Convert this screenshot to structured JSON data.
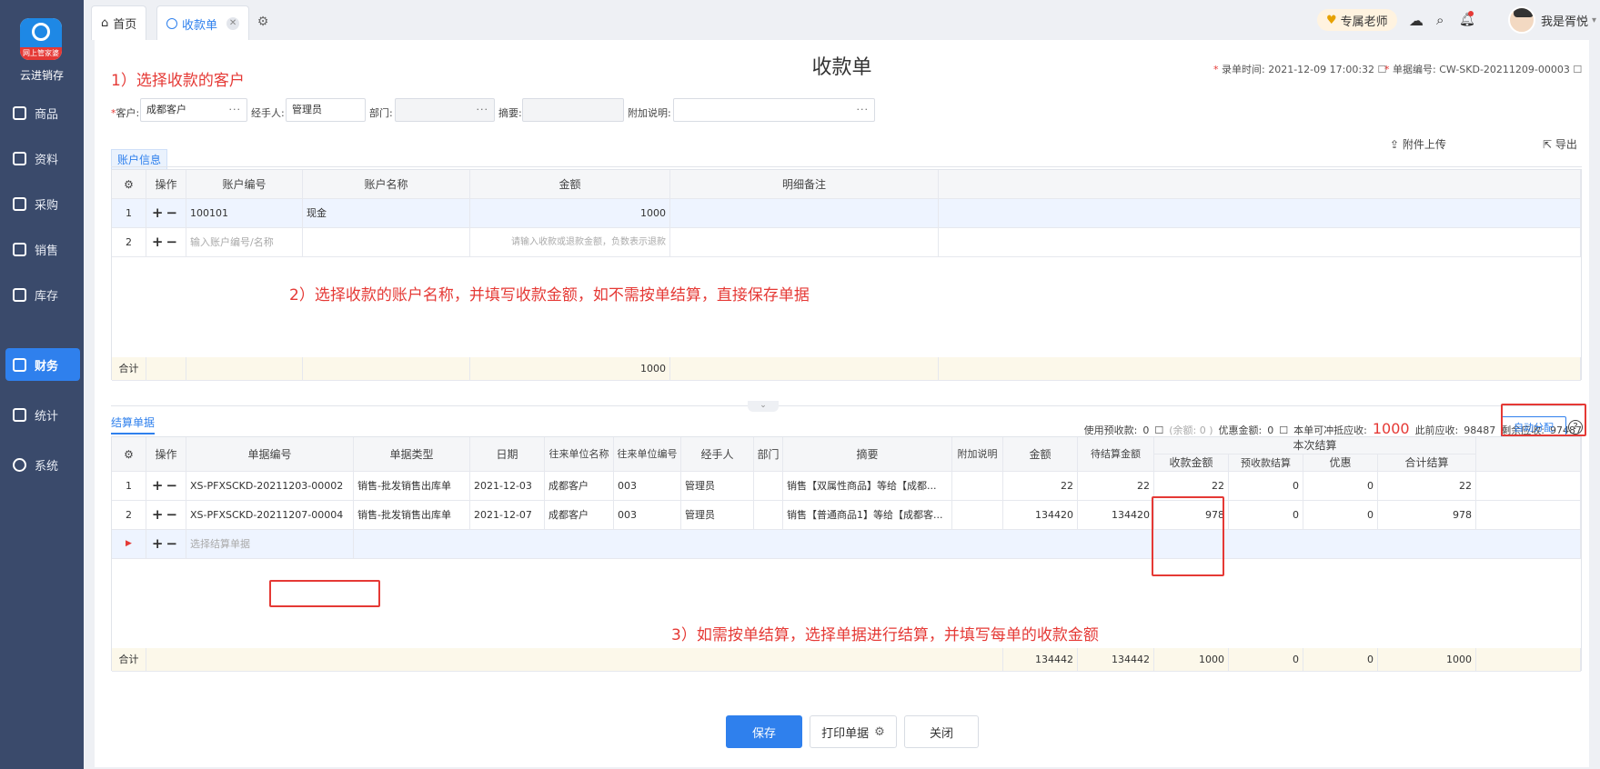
{
  "app": {
    "brand": "云进销存",
    "logo_band": "网上管家婆"
  },
  "nav": [
    {
      "label": "商品",
      "icon": "goods-icon"
    },
    {
      "label": "资料",
      "icon": "profile-icon"
    },
    {
      "label": "采购",
      "icon": "purchase-icon"
    },
    {
      "label": "销售",
      "icon": "sales-icon"
    },
    {
      "label": "库存",
      "icon": "inventory-icon"
    },
    {
      "label": "财务",
      "icon": "finance-icon",
      "active": true
    },
    {
      "label": "统计",
      "icon": "stats-icon"
    },
    {
      "label": "系统",
      "icon": "system-icon"
    }
  ],
  "tabs": [
    {
      "label": "首页"
    },
    {
      "label": "收款单",
      "active": true
    }
  ],
  "topbar": {
    "teacher": "专属老师",
    "user": "我是胥悦"
  },
  "page": {
    "title": "收款单",
    "entry_time_label": "录单时间:",
    "entry_time": "2021-12-09 17:00:32",
    "doc_no_label": "单据编号:",
    "doc_no": "CW-SKD-20211209-00003"
  },
  "annotations": {
    "a1": "1）选择收款的客户",
    "a2": "2）选择收款的账户名称，并填写收款金额，如不需按单结算，直接保存单据",
    "a3": "3）如需按单结算，选择单据进行结算，并填写每单的收款金额"
  },
  "form": {
    "customer_label": "客户:",
    "customer": "成都客户",
    "handler_label": "经手人:",
    "handler": "管理员",
    "dept_label": "部门:",
    "dept": "",
    "summary_label": "摘要:",
    "summary": "",
    "note_label": "附加说明:",
    "note": ""
  },
  "actions": {
    "upload": "附件上传",
    "export": "导出"
  },
  "account": {
    "tab": "账户信息",
    "headers": [
      "操作",
      "账户编号",
      "账户名称",
      "金额",
      "明细备注"
    ],
    "rows": [
      {
        "no": "1",
        "code": "100101",
        "name": "现金",
        "amount": "1000",
        "remark": ""
      },
      {
        "no": "2",
        "code": "输入账户编号/名称",
        "name": "",
        "amount": "请输入收款或退款金额，负数表示退款",
        "remark": ""
      }
    ],
    "total_label": "合计",
    "total": "1000"
  },
  "summary": {
    "prepay_label": "使用预收款:",
    "prepay": "0",
    "balance": "(余额: 0 )",
    "discount_label": "优惠金额:",
    "discount": "0",
    "offset_label": "本单可冲抵应收:",
    "offset": "1000",
    "before_label": "此前应收:",
    "before": "98487",
    "remain_label": "剩余应收:",
    "remain": "97487"
  },
  "settle": {
    "tab": "结算单据",
    "auto_btn": "自动分配",
    "group_header": "本次结算",
    "headers": [
      "操作",
      "单据编号",
      "单据类型",
      "日期",
      "往来单位名称",
      "往来单位编号",
      "经手人",
      "部门",
      "摘要",
      "附加说明",
      "金额",
      "待结算金额",
      "收款金额",
      "预收款结算",
      "优惠",
      "合计结算"
    ],
    "rows": [
      {
        "no": "1",
        "code": "XS-PFXSCKD-20211203-00002",
        "type": "销售-批发销售出库单",
        "date": "2021-12-03",
        "unit": "成都客户",
        "unit_no": "003",
        "handler": "管理员",
        "dept": "",
        "summary": "销售【双属性商品】等给【成都...",
        "note": "",
        "amount": "22",
        "pending": "22",
        "receive": "22",
        "prepay": "0",
        "discount": "0",
        "total": "22"
      },
      {
        "no": "2",
        "code": "XS-PFXSCKD-20211207-00004",
        "type": "销售-批发销售出库单",
        "date": "2021-12-07",
        "unit": "成都客户",
        "unit_no": "003",
        "handler": "管理员",
        "dept": "",
        "summary": "销售【普通商品1】等给【成都客...",
        "note": "",
        "amount": "134420",
        "pending": "134420",
        "receive": "978",
        "prepay": "0",
        "discount": "0",
        "total": "978"
      }
    ],
    "new_row_placeholder": "选择结算单据",
    "total_label": "合计",
    "totals": {
      "amount": "134442",
      "pending": "134442",
      "receive": "1000",
      "prepay": "0",
      "discount": "0",
      "total": "1000"
    }
  },
  "buttons": {
    "save": "保存",
    "print": "打印单据",
    "close": "关闭"
  }
}
